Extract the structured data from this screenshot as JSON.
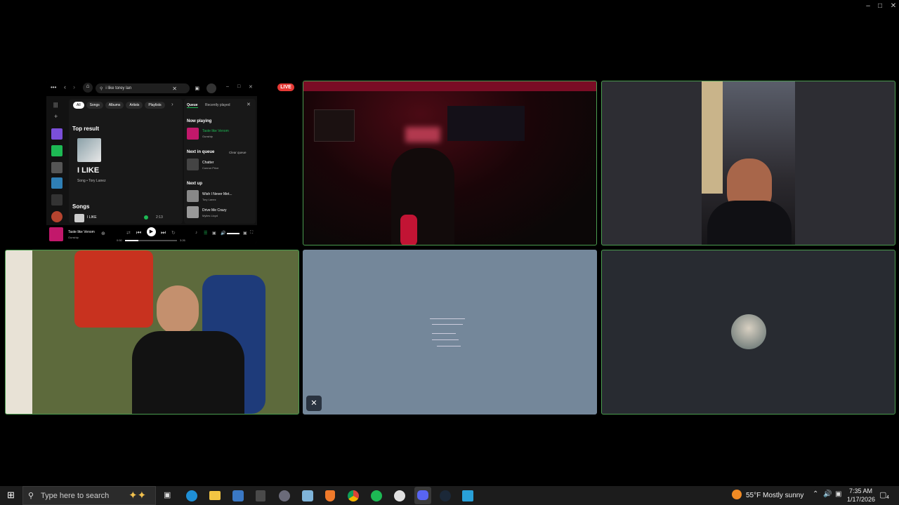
{
  "spotify": {
    "search_value": "i like torey lan",
    "filters": [
      "All",
      "Songs",
      "Albums",
      "Artists",
      "Playlists"
    ],
    "queue_tabs": [
      "Queue",
      "Recently played"
    ],
    "top_result_heading": "Top result",
    "top_result_title": "I LIKE",
    "top_result_sub": "Song • Tory Lanez",
    "songs_heading": "Songs",
    "song_row_title": "I LIKE",
    "song_row_duration": "2:13",
    "now_playing_heading": "Now playing",
    "now_playing_title": "Taste like Venom",
    "now_playing_artist": "Gunship",
    "next_in_queue_heading": "Next in queue",
    "clear_queue": "Clear queue",
    "queue_item_title": "Chatter",
    "queue_item_artist": "Connor Price",
    "next_up_heading": "Next up",
    "next_up_1_title": "Wish I Never Met...",
    "next_up_1_artist": "Tory Lanez",
    "next_up_2_title": "Drive Me Crazy",
    "next_up_2_artist": "Mylies Lloyd",
    "player_title": "Taste like Venom",
    "player_artist": "Gunship",
    "elapsed": "0:50",
    "total": "3:26",
    "progress_fraction": 0.26
  },
  "stream": {
    "live_label": "LIVE"
  },
  "taskbar": {
    "search_placeholder": "Type here to search",
    "weather": "55°F  Mostly sunny",
    "time": "7:35 AM",
    "date": "1/17/2026",
    "notification_count": "4"
  }
}
